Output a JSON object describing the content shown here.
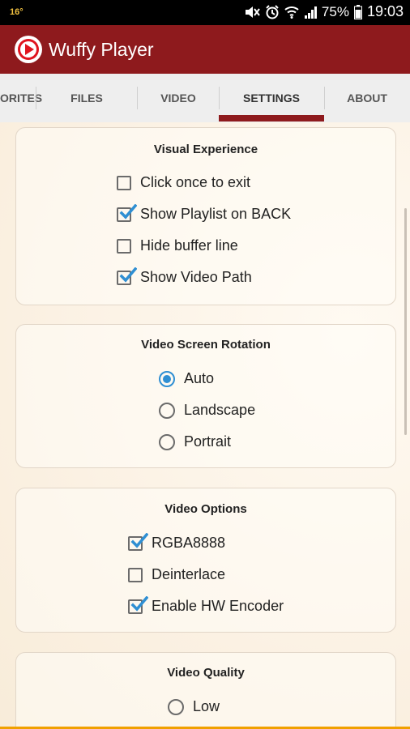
{
  "status_bar": {
    "temperature": "16°",
    "battery_percent": "75%",
    "time": "19:03",
    "icons": [
      "mute-icon",
      "alarm-icon",
      "wifi-icon",
      "signal-icon",
      "battery-icon"
    ]
  },
  "app": {
    "title": "Wuffy Player",
    "brand_color": "#8e1a1d"
  },
  "tabs": [
    {
      "label": "ORITES"
    },
    {
      "label": "FILES"
    },
    {
      "label": "VIDEO"
    },
    {
      "label": "SETTINGS",
      "active": true
    },
    {
      "label": "ABOUT"
    }
  ],
  "sections": {
    "visual_experience": {
      "title": "Visual Experience",
      "options": [
        {
          "label": "Click once to exit",
          "checked": false
        },
        {
          "label": "Show Playlist on BACK",
          "checked": true
        },
        {
          "label": "Hide buffer line",
          "checked": false
        },
        {
          "label": "Show Video Path",
          "checked": true
        }
      ]
    },
    "rotation": {
      "title": "Video Screen Rotation",
      "options": [
        {
          "label": "Auto",
          "selected": true
        },
        {
          "label": "Landscape",
          "selected": false
        },
        {
          "label": "Portrait",
          "selected": false
        }
      ]
    },
    "video_options": {
      "title": "Video Options",
      "options": [
        {
          "label": "RGBA8888",
          "checked": true
        },
        {
          "label": "Deinterlace",
          "checked": false
        },
        {
          "label": "Enable HW Encoder",
          "checked": true
        }
      ]
    },
    "quality": {
      "title": "Video Quality",
      "options": [
        {
          "label": "Low",
          "selected": false
        }
      ]
    }
  },
  "colors": {
    "accent_blue": "#2f8fd3",
    "status_bar_bg": "#000000"
  }
}
